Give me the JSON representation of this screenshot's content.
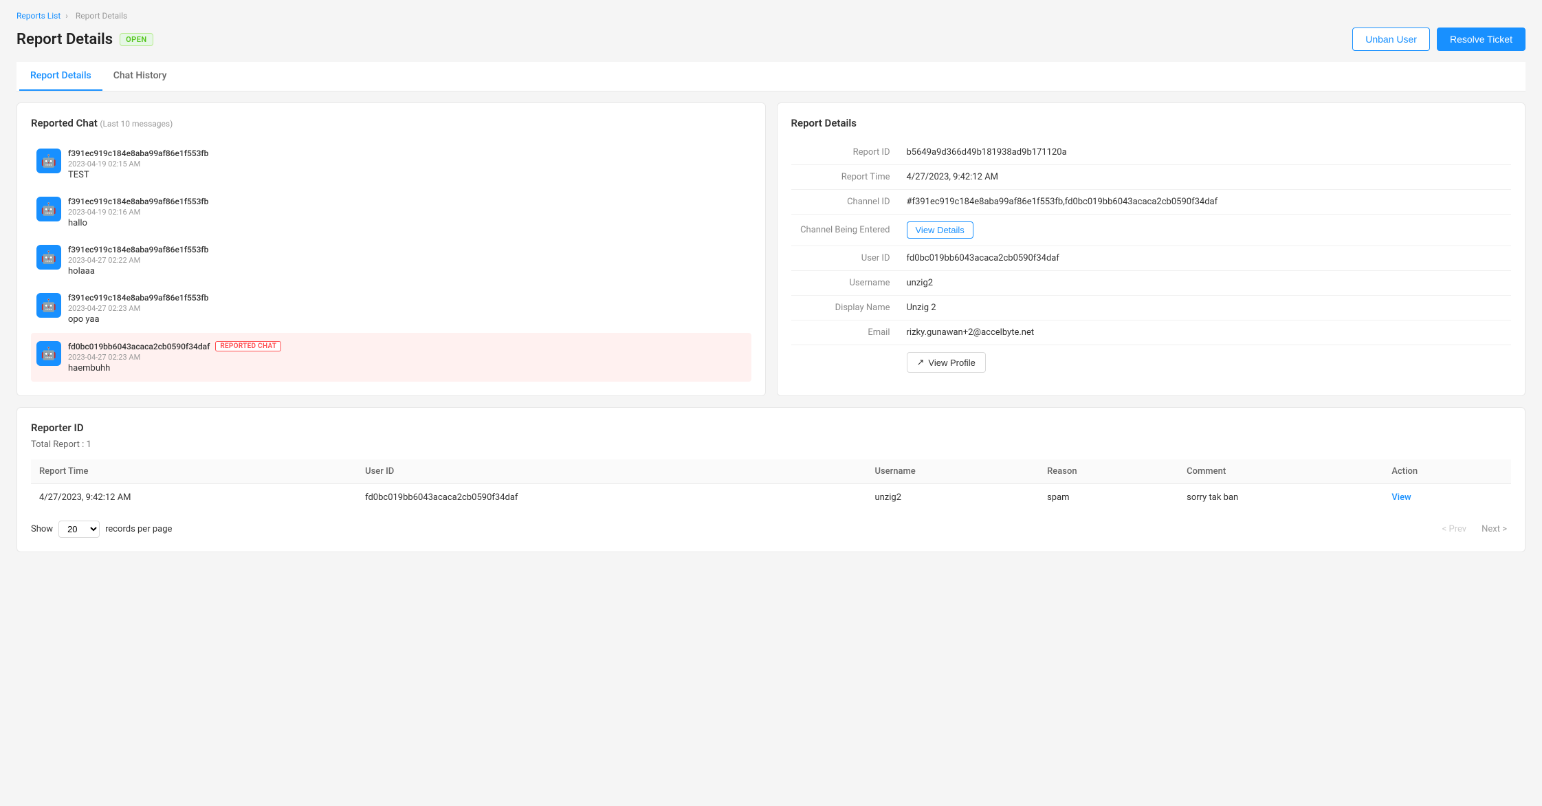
{
  "breadcrumb": {
    "parent": "Reports List",
    "current": "Report Details"
  },
  "page": {
    "title": "Report Details",
    "status": "OPEN"
  },
  "header": {
    "unban_btn": "Unban User",
    "resolve_btn": "Resolve Ticket"
  },
  "tabs": [
    {
      "id": "report-details",
      "label": "Report Details",
      "active": true
    },
    {
      "id": "chat-history",
      "label": "Chat History",
      "active": false
    }
  ],
  "reported_chat": {
    "title": "Reported Chat",
    "subtitle": "Last 10 messages",
    "messages": [
      {
        "user_id": "f391ec919c184e8aba99af86e1f553fb",
        "timestamp": "2023-04-19 02:15 AM",
        "message": "TEST",
        "reported": false
      },
      {
        "user_id": "f391ec919c184e8aba99af86e1f553fb",
        "timestamp": "2023-04-19 02:16 AM",
        "message": "hallo",
        "reported": false
      },
      {
        "user_id": "f391ec919c184e8aba99af86e1f553fb",
        "timestamp": "2023-04-27 02:22 AM",
        "message": "holaaa",
        "reported": false
      },
      {
        "user_id": "f391ec919c184e8aba99af86e1f553fb",
        "timestamp": "2023-04-27 02:23 AM",
        "message": "opo yaa",
        "reported": false
      },
      {
        "user_id": "fd0bc019bb6043acaca2cb0590f34daf",
        "timestamp": "2023-04-27 02:23 AM",
        "message": "haembuhh",
        "reported": true
      }
    ]
  },
  "report_details": {
    "title": "Report Details",
    "fields": {
      "report_id_label": "Report ID",
      "report_id_value": "b5649a9d366d49b181938ad9b171120a",
      "report_time_label": "Report Time",
      "report_time_value": "4/27/2023, 9:42:12 AM",
      "channel_id_label": "Channel ID",
      "channel_id_value": "#f391ec919c184e8aba99af86e1f553fb,fd0bc019bb6043acaca2cb0590f34daf",
      "channel_being_entered_label": "Channel Being Entered",
      "view_details_btn": "View Details",
      "user_id_label": "User ID",
      "user_id_value": "fd0bc019bb6043acaca2cb0590f34daf",
      "username_label": "Username",
      "username_value": "unzig2",
      "display_name_label": "Display Name",
      "display_name_value": "Unzig 2",
      "email_label": "Email",
      "email_value": "rizky.gunawan+2@accelbyte.net",
      "view_profile_btn": "View Profile"
    }
  },
  "reporter_section": {
    "title": "Reporter ID",
    "total_report": "Total Report : 1",
    "columns": [
      "Report Time",
      "User ID",
      "Username",
      "Reason",
      "Comment",
      "Action"
    ],
    "rows": [
      {
        "report_time": "4/27/2023, 9:42:12 AM",
        "user_id": "fd0bc019bb6043acaca2cb0590f34daf",
        "username": "unzig2",
        "reason": "spam",
        "comment": "sorry tak ban",
        "action": "View"
      }
    ]
  },
  "table_footer": {
    "show_label": "Show",
    "records_label": "records per page",
    "per_page": "20",
    "prev": "< Prev",
    "next": "Next >"
  }
}
